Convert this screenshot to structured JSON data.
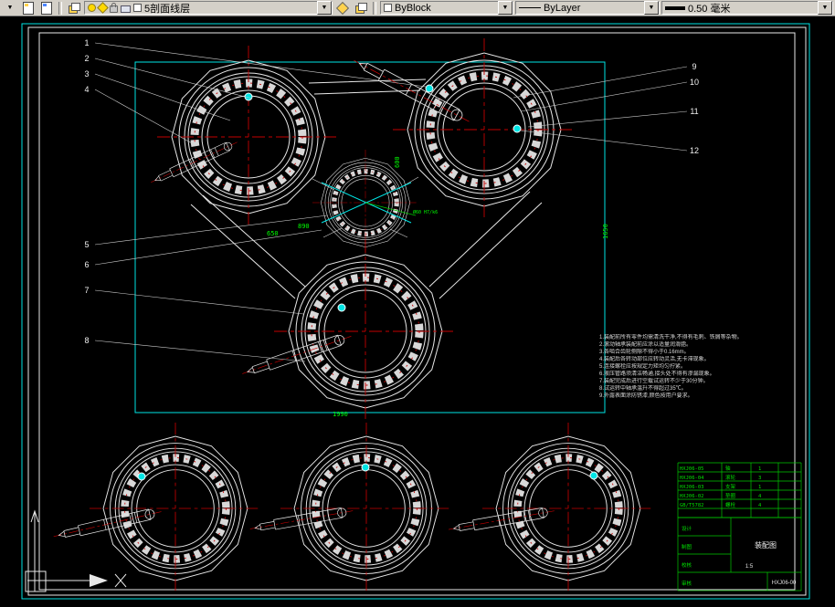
{
  "toolbar": {
    "layer_value": "5剖面线层",
    "color_value": "ByBlock",
    "linetype_value": "ByLayer",
    "lineweight_value": "0.50 毫米"
  },
  "callouts": {
    "left": [
      "1",
      "2",
      "3",
      "4",
      "5",
      "6",
      "7",
      "8"
    ],
    "right": [
      "9",
      "10",
      "11",
      "12"
    ]
  },
  "dimensions": {
    "d1": "650",
    "d2": "890",
    "d3": "600",
    "d4": "1990",
    "d5": "1650",
    "d6": "Ø60 H7/k6"
  },
  "notes": {
    "lines": [
      "1.装配前所有零件均需清洗干净,不得有毛刺、铁屑等杂物。",
      "2.滚动轴承装配前应涂以适量润滑脂。",
      "3.各啮合齿轮侧隙不得小于0.16mm。",
      "4.装配后各转动部位应转动灵活,无卡滞现象。",
      "5.连接螺栓应按规定力矩均匀拧紧。",
      "6.液压管路须清洁畅通,接头处不得有渗漏现象。",
      "7.装配完成后进行空载试运转不少于30分钟。",
      "8.试运转中轴承温升不得超过35℃。",
      "9.外露表面涂防锈漆,颜色按用户要求。"
    ]
  },
  "title_block": {
    "parts": [
      {
        "code": "HXJ06-05",
        "name": "轴",
        "qty": "1"
      },
      {
        "code": "HXJ06-04",
        "name": "滚轮",
        "qty": "3"
      },
      {
        "code": "HXJ06-03",
        "name": "支架",
        "qty": "1"
      },
      {
        "code": "HXJ06-02",
        "name": "垫圈",
        "qty": "4"
      },
      {
        "code": "GB/T5782",
        "name": "螺栓",
        "qty": "4"
      }
    ],
    "labels": [
      "设计",
      "制图",
      "校核",
      "审核"
    ],
    "title": "装配图",
    "number": "HXJ06-00",
    "scale": "1:5"
  },
  "colors": {
    "line_white": "#e8e8e8",
    "centerline_red": "#c40000",
    "frame_cyan": "#00e5e5",
    "dim_green": "#00ff00",
    "toolbar_gray": "#d4d0c8"
  }
}
